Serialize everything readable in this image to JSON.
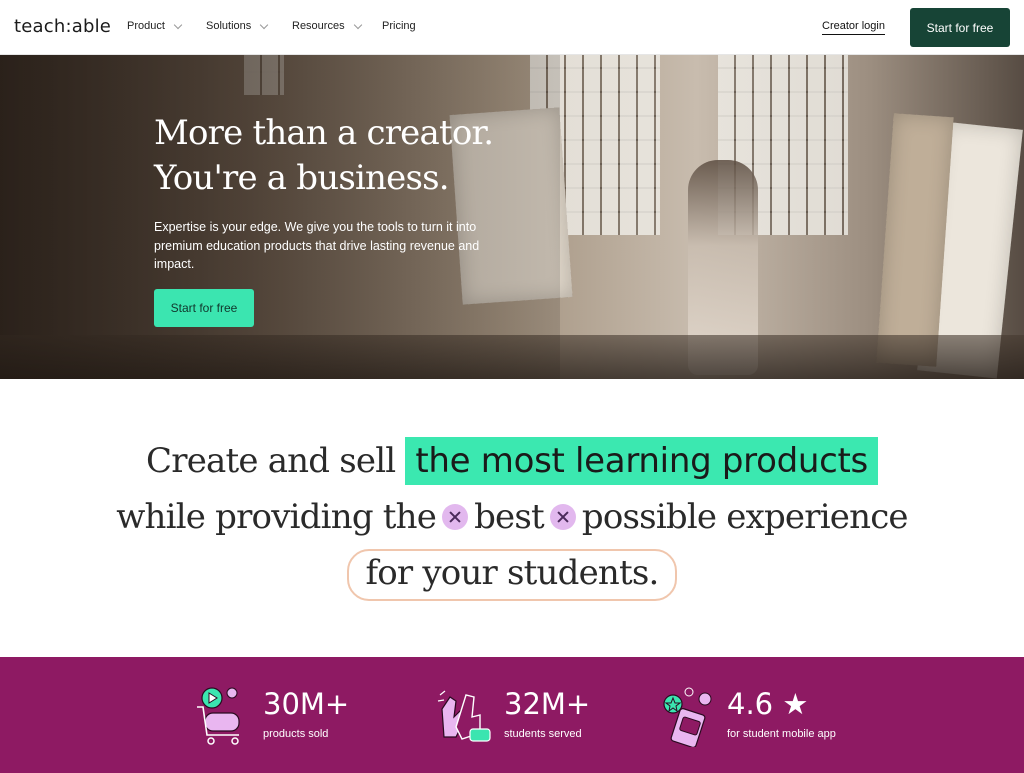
{
  "nav": {
    "logo": "teach:able",
    "items": [
      {
        "label": "Product"
      },
      {
        "label": "Solutions"
      },
      {
        "label": "Resources"
      },
      {
        "label": "Pricing"
      }
    ],
    "login": "Creator login",
    "cta": "Start for free"
  },
  "hero": {
    "title_line1": "More than a creator.",
    "title_line2": "You're a business.",
    "subtitle": "Expertise is your edge. We give you the tools to turn it into premium education products that drive lasting revenue and impact.",
    "cta": "Start for free"
  },
  "headline": {
    "part1": "Create and sell",
    "highlight": "the most learning products",
    "part2a": "while providing the",
    "part2b": "best",
    "part2c": "possible experience",
    "part3": "for your students."
  },
  "stats": [
    {
      "value": "30M+",
      "label": "products sold",
      "icon": "shopping-cart-icon"
    },
    {
      "value": "32M+",
      "label": "students served",
      "icon": "clapping-hands-icon"
    },
    {
      "value": "4.6 ★",
      "label": "for student mobile app",
      "icon": "mobile-app-icon"
    }
  ],
  "colors": {
    "brand_dark": "#174436",
    "accent_mint": "#3be5b0",
    "stats_bg": "#8e1a63",
    "pill_border": "#f0c6ad"
  }
}
